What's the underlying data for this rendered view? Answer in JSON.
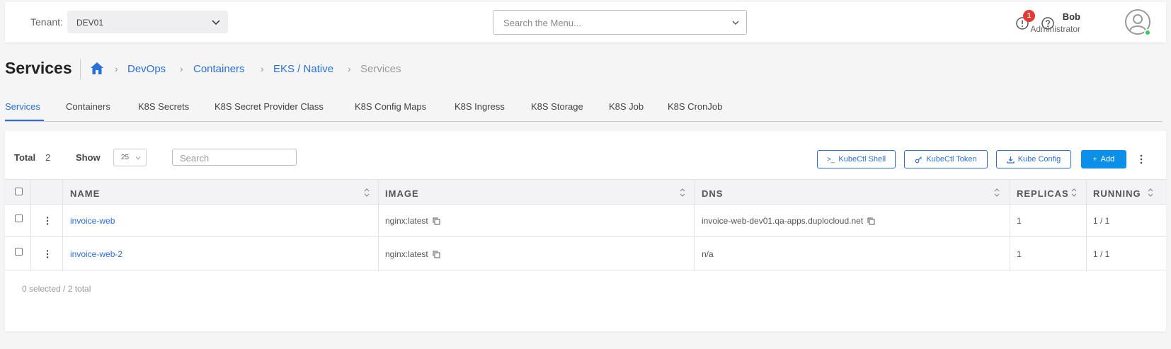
{
  "header": {
    "tenant_label": "Tenant:",
    "tenant_value": "DEV01",
    "menu_search_placeholder": "Search the Menu...",
    "alert_count": "1",
    "user_name": "Bob",
    "user_role": "Administrator"
  },
  "page": {
    "title": "Services",
    "breadcrumbs": [
      "DevOps",
      "Containers",
      "EKS / Native",
      "Services"
    ]
  },
  "tabs": [
    "Services",
    "Containers",
    "K8S Secrets",
    "K8S Secret Provider Class",
    "K8S Config Maps",
    "K8S Ingress",
    "K8S Storage",
    "K8S Job",
    "K8S CronJob"
  ],
  "toolbar": {
    "total_label": "Total",
    "total_value": "2",
    "show_label": "Show",
    "page_size": "25",
    "search_placeholder": "Search",
    "kubectl_shell": "KubeCtl Shell",
    "kubectl_token": "KubeCtl Token",
    "kube_config": "Kube Config",
    "add": "Add"
  },
  "table": {
    "columns": [
      "NAME",
      "IMAGE",
      "DNS",
      "REPLICAS",
      "RUNNING"
    ],
    "rows": [
      {
        "name": "invoice-web",
        "image": "nginx:latest",
        "dns": "invoice-web-dev01.qa-apps.duplocloud.net",
        "replicas": "1",
        "running": "1 / 1"
      },
      {
        "name": "invoice-web-2",
        "image": "nginx:latest",
        "dns": "n/a",
        "replicas": "1",
        "running": "1 / 1"
      }
    ]
  },
  "footer": {
    "selection_summary": "0 selected / 2 total"
  },
  "colors": {
    "accent": "#2b6fd8",
    "primary_button": "#0b8fe8",
    "badge": "#e53935",
    "online": "#2bd15a"
  }
}
